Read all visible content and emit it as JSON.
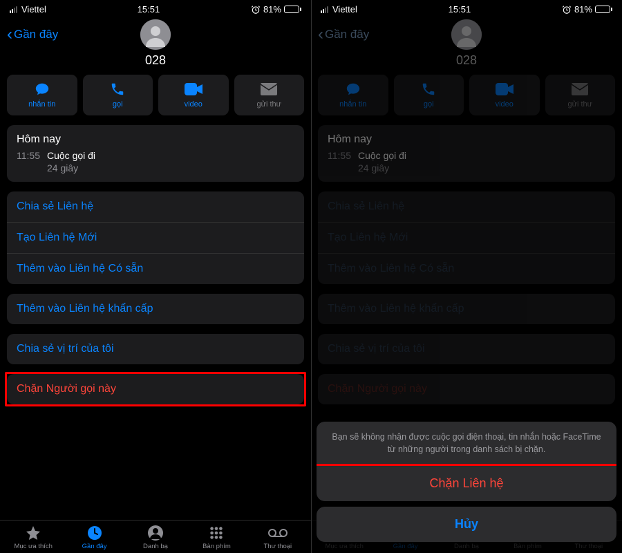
{
  "status": {
    "carrier": "Viettel",
    "time": "15:51",
    "battery_pct": "81%"
  },
  "nav": {
    "back_label": "Gần đây",
    "contact_number": "028"
  },
  "actions": {
    "message": "nhắn tin",
    "call": "gọi",
    "video": "video",
    "mail": "gửi thư"
  },
  "call_log": {
    "title": "Hôm nay",
    "time": "11:55",
    "type": "Cuộc gọi đi",
    "duration": "24 giây"
  },
  "menu": {
    "share_contact": "Chia sẻ Liên hệ",
    "create_contact": "Tạo Liên hệ Mới",
    "add_existing": "Thêm vào Liên hệ Có sẵn",
    "add_emergency": "Thêm vào Liên hệ khẩn cấp",
    "share_location": "Chia sẻ vị trí của tôi",
    "block_caller": "Chặn Người gọi này"
  },
  "tabs": {
    "favorites": "Mục ưa thích",
    "recents": "Gần đây",
    "contacts": "Danh bạ",
    "keypad": "Bàn phím",
    "voicemail": "Thư thoại"
  },
  "sheet": {
    "message": "Bạn sẽ không nhận được cuộc gọi điện thoại, tin nhắn hoặc FaceTime từ những người trong danh sách bị chặn.",
    "block": "Chặn Liên hệ",
    "cancel": "Hủy"
  }
}
